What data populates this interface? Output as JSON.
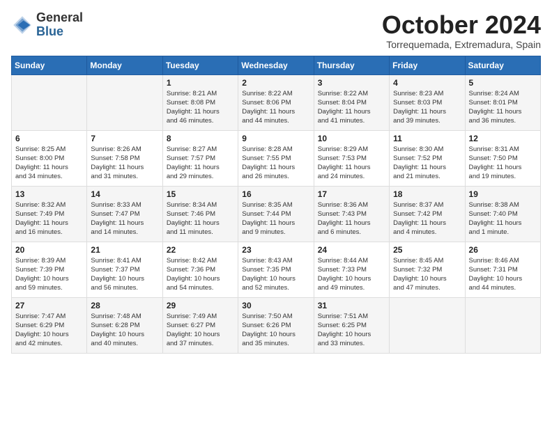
{
  "header": {
    "logo_general": "General",
    "logo_blue": "Blue",
    "month_title": "October 2024",
    "location": "Torrequemada, Extremadura, Spain"
  },
  "days_of_week": [
    "Sunday",
    "Monday",
    "Tuesday",
    "Wednesday",
    "Thursday",
    "Friday",
    "Saturday"
  ],
  "weeks": [
    [
      {
        "day": "",
        "info": ""
      },
      {
        "day": "",
        "info": ""
      },
      {
        "day": "1",
        "info": "Sunrise: 8:21 AM\nSunset: 8:08 PM\nDaylight: 11 hours\nand 46 minutes."
      },
      {
        "day": "2",
        "info": "Sunrise: 8:22 AM\nSunset: 8:06 PM\nDaylight: 11 hours\nand 44 minutes."
      },
      {
        "day": "3",
        "info": "Sunrise: 8:22 AM\nSunset: 8:04 PM\nDaylight: 11 hours\nand 41 minutes."
      },
      {
        "day": "4",
        "info": "Sunrise: 8:23 AM\nSunset: 8:03 PM\nDaylight: 11 hours\nand 39 minutes."
      },
      {
        "day": "5",
        "info": "Sunrise: 8:24 AM\nSunset: 8:01 PM\nDaylight: 11 hours\nand 36 minutes."
      }
    ],
    [
      {
        "day": "6",
        "info": "Sunrise: 8:25 AM\nSunset: 8:00 PM\nDaylight: 11 hours\nand 34 minutes."
      },
      {
        "day": "7",
        "info": "Sunrise: 8:26 AM\nSunset: 7:58 PM\nDaylight: 11 hours\nand 31 minutes."
      },
      {
        "day": "8",
        "info": "Sunrise: 8:27 AM\nSunset: 7:57 PM\nDaylight: 11 hours\nand 29 minutes."
      },
      {
        "day": "9",
        "info": "Sunrise: 8:28 AM\nSunset: 7:55 PM\nDaylight: 11 hours\nand 26 minutes."
      },
      {
        "day": "10",
        "info": "Sunrise: 8:29 AM\nSunset: 7:53 PM\nDaylight: 11 hours\nand 24 minutes."
      },
      {
        "day": "11",
        "info": "Sunrise: 8:30 AM\nSunset: 7:52 PM\nDaylight: 11 hours\nand 21 minutes."
      },
      {
        "day": "12",
        "info": "Sunrise: 8:31 AM\nSunset: 7:50 PM\nDaylight: 11 hours\nand 19 minutes."
      }
    ],
    [
      {
        "day": "13",
        "info": "Sunrise: 8:32 AM\nSunset: 7:49 PM\nDaylight: 11 hours\nand 16 minutes."
      },
      {
        "day": "14",
        "info": "Sunrise: 8:33 AM\nSunset: 7:47 PM\nDaylight: 11 hours\nand 14 minutes."
      },
      {
        "day": "15",
        "info": "Sunrise: 8:34 AM\nSunset: 7:46 PM\nDaylight: 11 hours\nand 11 minutes."
      },
      {
        "day": "16",
        "info": "Sunrise: 8:35 AM\nSunset: 7:44 PM\nDaylight: 11 hours\nand 9 minutes."
      },
      {
        "day": "17",
        "info": "Sunrise: 8:36 AM\nSunset: 7:43 PM\nDaylight: 11 hours\nand 6 minutes."
      },
      {
        "day": "18",
        "info": "Sunrise: 8:37 AM\nSunset: 7:42 PM\nDaylight: 11 hours\nand 4 minutes."
      },
      {
        "day": "19",
        "info": "Sunrise: 8:38 AM\nSunset: 7:40 PM\nDaylight: 11 hours\nand 1 minute."
      }
    ],
    [
      {
        "day": "20",
        "info": "Sunrise: 8:39 AM\nSunset: 7:39 PM\nDaylight: 10 hours\nand 59 minutes."
      },
      {
        "day": "21",
        "info": "Sunrise: 8:41 AM\nSunset: 7:37 PM\nDaylight: 10 hours\nand 56 minutes."
      },
      {
        "day": "22",
        "info": "Sunrise: 8:42 AM\nSunset: 7:36 PM\nDaylight: 10 hours\nand 54 minutes."
      },
      {
        "day": "23",
        "info": "Sunrise: 8:43 AM\nSunset: 7:35 PM\nDaylight: 10 hours\nand 52 minutes."
      },
      {
        "day": "24",
        "info": "Sunrise: 8:44 AM\nSunset: 7:33 PM\nDaylight: 10 hours\nand 49 minutes."
      },
      {
        "day": "25",
        "info": "Sunrise: 8:45 AM\nSunset: 7:32 PM\nDaylight: 10 hours\nand 47 minutes."
      },
      {
        "day": "26",
        "info": "Sunrise: 8:46 AM\nSunset: 7:31 PM\nDaylight: 10 hours\nand 44 minutes."
      }
    ],
    [
      {
        "day": "27",
        "info": "Sunrise: 7:47 AM\nSunset: 6:29 PM\nDaylight: 10 hours\nand 42 minutes."
      },
      {
        "day": "28",
        "info": "Sunrise: 7:48 AM\nSunset: 6:28 PM\nDaylight: 10 hours\nand 40 minutes."
      },
      {
        "day": "29",
        "info": "Sunrise: 7:49 AM\nSunset: 6:27 PM\nDaylight: 10 hours\nand 37 minutes."
      },
      {
        "day": "30",
        "info": "Sunrise: 7:50 AM\nSunset: 6:26 PM\nDaylight: 10 hours\nand 35 minutes."
      },
      {
        "day": "31",
        "info": "Sunrise: 7:51 AM\nSunset: 6:25 PM\nDaylight: 10 hours\nand 33 minutes."
      },
      {
        "day": "",
        "info": ""
      },
      {
        "day": "",
        "info": ""
      }
    ]
  ]
}
